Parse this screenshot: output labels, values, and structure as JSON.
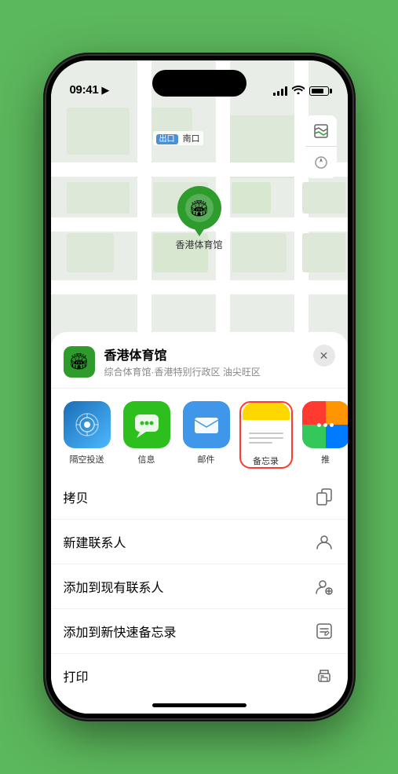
{
  "status_bar": {
    "time": "09:41",
    "location_arrow": "▸"
  },
  "map": {
    "label": "南口"
  },
  "location_marker": {
    "name": "香港体育馆",
    "emoji": "🏟"
  },
  "location_header": {
    "name": "香港体育馆",
    "description": "综合体育馆·香港特别行政区 油尖旺区",
    "close_label": "✕"
  },
  "share_row": {
    "items": [
      {
        "id": "airdrop",
        "label": "隔空投送",
        "emoji": "📡"
      },
      {
        "id": "messages",
        "label": "信息",
        "emoji": "💬"
      },
      {
        "id": "mail",
        "label": "邮件",
        "emoji": "✉️"
      },
      {
        "id": "notes",
        "label": "备忘录",
        "emoji": "📝"
      },
      {
        "id": "more",
        "label": "推",
        "emoji": "···"
      }
    ]
  },
  "actions": [
    {
      "id": "copy",
      "label": "拷贝",
      "icon": "⎘"
    },
    {
      "id": "new-contact",
      "label": "新建联系人",
      "icon": "👤"
    },
    {
      "id": "add-contact",
      "label": "添加到现有联系人",
      "icon": "👤+"
    },
    {
      "id": "quick-note",
      "label": "添加到新快速备忘录",
      "icon": "🗒"
    },
    {
      "id": "print",
      "label": "打印",
      "icon": "🖨"
    }
  ],
  "map_controls": {
    "map_icon": "🗺",
    "compass_icon": "◎"
  }
}
